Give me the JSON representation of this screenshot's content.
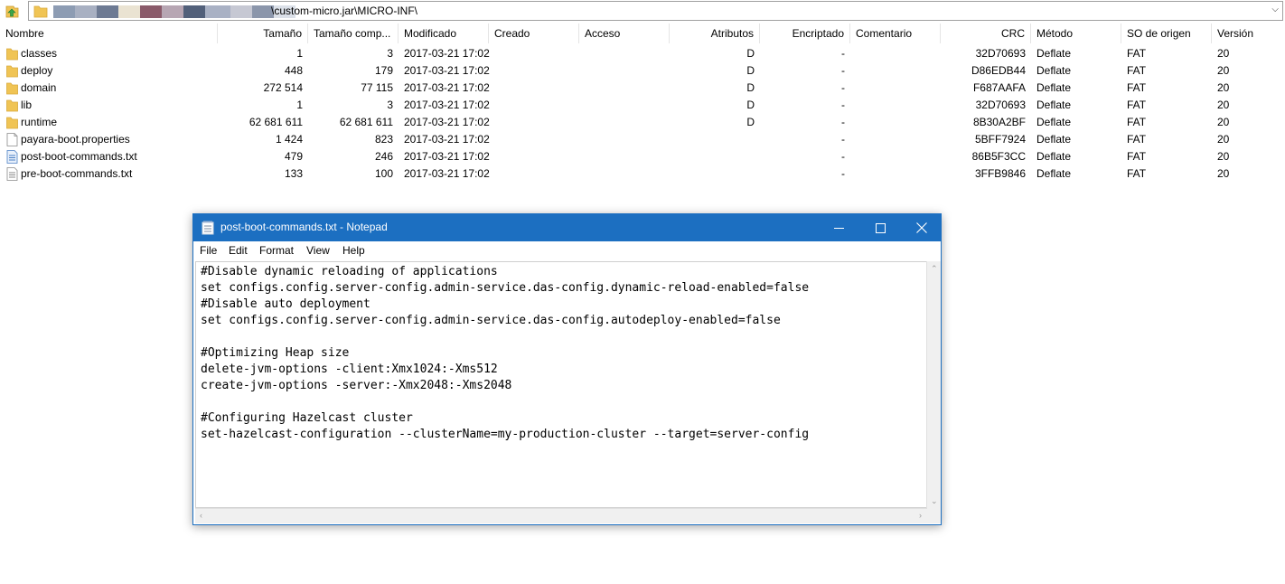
{
  "address": {
    "path": "\\custom-micro.jar\\MICRO-INF\\",
    "redacted_colors": [
      "#8d9cb3",
      "#a8b0c2",
      "#6d7a93",
      "#eae3d2",
      "#8a5a6a",
      "#b7a6b3",
      "#52607a",
      "#a9b1c4",
      "#c6c8d3",
      "#8b96ab",
      "#dbe0e8"
    ]
  },
  "columns": {
    "name": "Nombre",
    "size": "Tamaño",
    "packed": "Tamaño comp...",
    "modified": "Modificado",
    "created": "Creado",
    "accessed": "Acceso",
    "attributes": "Atributos",
    "encrypted": "Encriptado",
    "comment": "Comentario",
    "crc": "CRC",
    "method": "Método",
    "host_os": "SO de origen",
    "version": "Versión"
  },
  "files": [
    {
      "name": "classes",
      "type": "folder",
      "size": "1",
      "packed": "3",
      "modified": "2017-03-21 17:02",
      "attributes": "D",
      "encrypted": "-",
      "crc": "32D70693",
      "method": "Deflate",
      "host_os": "FAT",
      "version": "20"
    },
    {
      "name": "deploy",
      "type": "folder",
      "size": "448",
      "packed": "179",
      "modified": "2017-03-21 17:02",
      "attributes": "D",
      "encrypted": "-",
      "crc": "D86EDB44",
      "method": "Deflate",
      "host_os": "FAT",
      "version": "20"
    },
    {
      "name": "domain",
      "type": "folder",
      "size": "272 514",
      "packed": "77 115",
      "modified": "2017-03-21 17:02",
      "attributes": "D",
      "encrypted": "-",
      "crc": "F687AAFA",
      "method": "Deflate",
      "host_os": "FAT",
      "version": "20"
    },
    {
      "name": "lib",
      "type": "folder",
      "size": "1",
      "packed": "3",
      "modified": "2017-03-21 17:02",
      "attributes": "D",
      "encrypted": "-",
      "crc": "32D70693",
      "method": "Deflate",
      "host_os": "FAT",
      "version": "20"
    },
    {
      "name": "runtime",
      "type": "folder",
      "size": "62 681 611",
      "packed": "62 681 611",
      "modified": "2017-03-21 17:02",
      "attributes": "D",
      "encrypted": "-",
      "crc": "8B30A2BF",
      "method": "Deflate",
      "host_os": "FAT",
      "version": "20"
    },
    {
      "name": "payara-boot.properties",
      "type": "file",
      "size": "1 424",
      "packed": "823",
      "modified": "2017-03-21 17:02",
      "attributes": "",
      "encrypted": "-",
      "crc": "5BFF7924",
      "method": "Deflate",
      "host_os": "FAT",
      "version": "20"
    },
    {
      "name": "post-boot-commands.txt",
      "type": "text",
      "size": "479",
      "packed": "246",
      "modified": "2017-03-21 17:02",
      "attributes": "",
      "encrypted": "-",
      "crc": "86B5F3CC",
      "method": "Deflate",
      "host_os": "FAT",
      "version": "20"
    },
    {
      "name": "pre-boot-commands.txt",
      "type": "text-plain",
      "size": "133",
      "packed": "100",
      "modified": "2017-03-21 17:02",
      "attributes": "",
      "encrypted": "-",
      "crc": "3FFB9846",
      "method": "Deflate",
      "host_os": "FAT",
      "version": "20"
    }
  ],
  "notepad": {
    "title": "post-boot-commands.txt - Notepad",
    "menu": [
      "File",
      "Edit",
      "Format",
      "View",
      "Help"
    ],
    "content": "#Disable dynamic reloading of applications\nset configs.config.server-config.admin-service.das-config.dynamic-reload-enabled=false\n#Disable auto deployment\nset configs.config.server-config.admin-service.das-config.autodeploy-enabled=false\n\n#Optimizing Heap size\ndelete-jvm-options -client:Xmx1024:-Xms512\ncreate-jvm-options -server:-Xmx2048:-Xms2048\n\n#Configuring Hazelcast cluster\nset-hazelcast-configuration --clusterName=my-production-cluster --target=server-config",
    "controls": {
      "minimize": "minimize-icon",
      "maximize": "maximize-icon",
      "close": "close-icon"
    }
  },
  "colors": {
    "titlebar": "#1c6fc1",
    "folder": "#f0c454",
    "folder_dark": "#d9a93a"
  }
}
